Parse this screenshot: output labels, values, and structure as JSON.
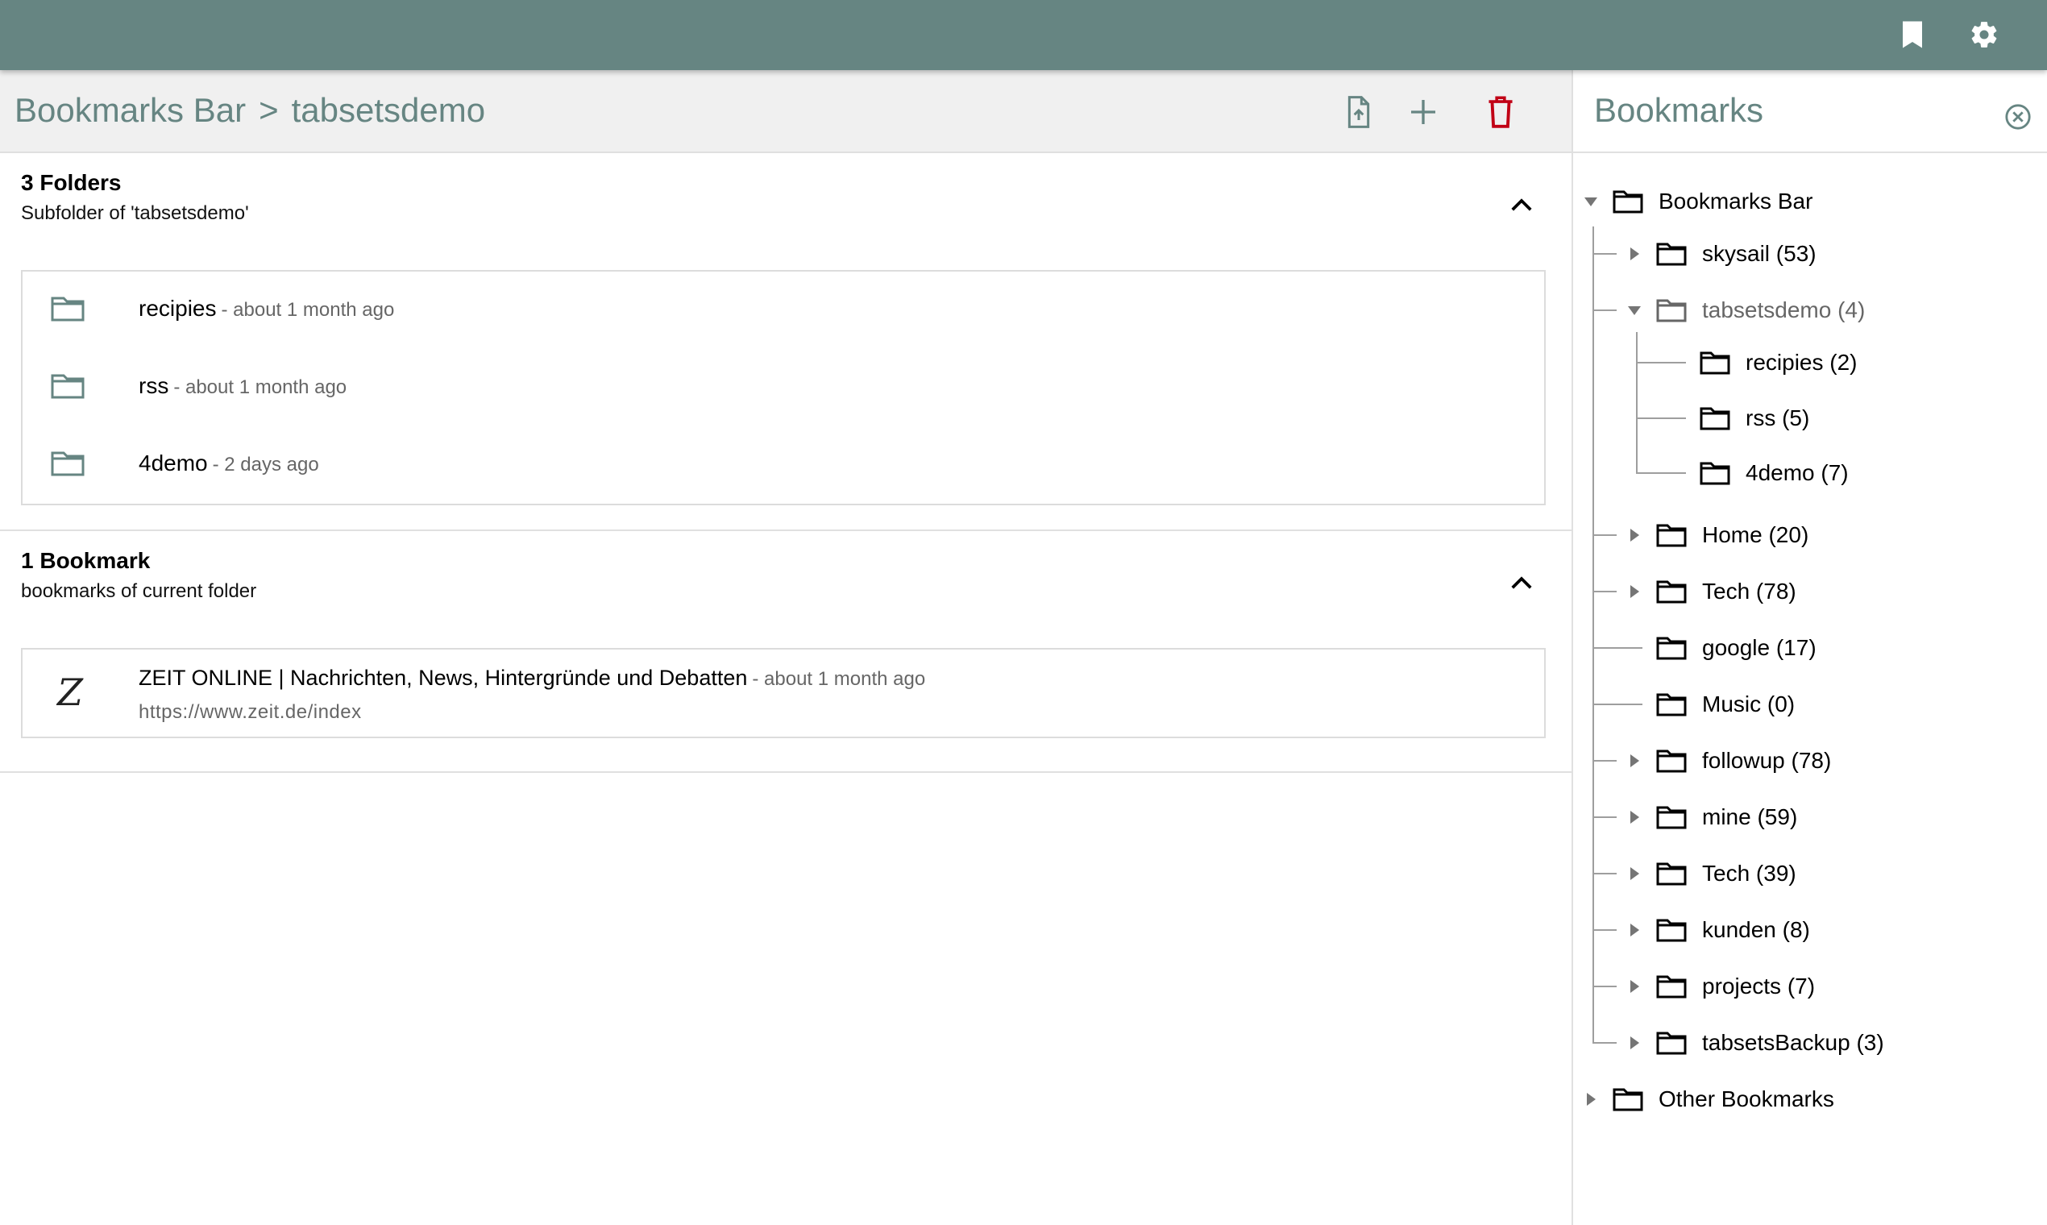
{
  "breadcrumb": {
    "root": "Bookmarks Bar",
    "separator": ">",
    "current": "tabsetsdemo"
  },
  "folders_section": {
    "title": "3 Folders",
    "subtitle": "Subfolder of 'tabsetsdemo'",
    "items": [
      {
        "name": "recipies",
        "meta": "- about 1 month ago"
      },
      {
        "name": "rss",
        "meta": "- about 1 month ago"
      },
      {
        "name": "4demo",
        "meta": "- 2 days ago"
      }
    ]
  },
  "bookmarks_section": {
    "title": "1 Bookmark",
    "subtitle": "bookmarks of current folder",
    "items": [
      {
        "logo": "Z",
        "name": "ZEIT ONLINE | Nachrichten, News, Hintergründe und Debatten",
        "meta": "- about 1 month ago",
        "url": "https://www.zeit.de/index"
      }
    ]
  },
  "sidebar": {
    "title": "Bookmarks",
    "tree": {
      "root": "Bookmarks Bar",
      "children": [
        "skysail (53)",
        "tabsetsdemo (4)",
        "recipies (2)",
        "rss (5)",
        "4demo (7)",
        "Home (20)",
        "Tech (78)",
        "google (17)",
        "Music (0)",
        "followup (78)",
        "mine (59)",
        "Tech (39)",
        "kunden (8)",
        "projects (7)",
        "tabsetsBackup (3)"
      ],
      "other": "Other Bookmarks"
    }
  },
  "icons": {
    "topbar": [
      "bookmark-icon",
      "gear-icon"
    ],
    "toolbar": [
      "file-upload-icon",
      "plus-icon",
      "trash-icon"
    ]
  },
  "colors": {
    "accent": "#668582",
    "danger": "#c10015",
    "toolbar_bg": "#f0f0f0"
  }
}
